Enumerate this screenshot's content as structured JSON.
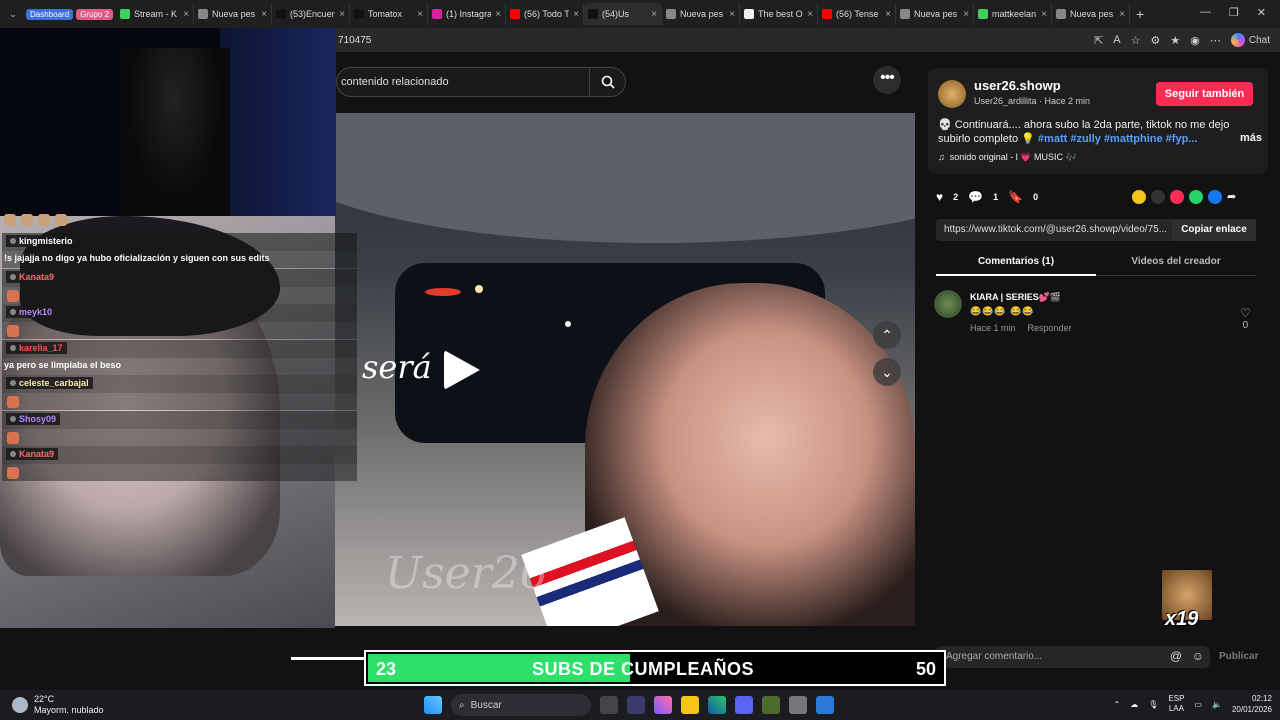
{
  "tabs": {
    "group1": "Dashboard",
    "group2": "Grupo 2",
    "items": [
      {
        "label": "Stream - K",
        "color": "#3ecf5e"
      },
      {
        "label": "Nueva pes",
        "color": "#888888"
      },
      {
        "label": "(53)Encuen",
        "color": "#111111"
      },
      {
        "label": "Tomatox",
        "color": "#111111"
      },
      {
        "label": "(1) Instagra",
        "color": "#d6249f"
      },
      {
        "label": "(56) Todo T",
        "color": "#ff0000"
      },
      {
        "label": "(54)Us",
        "color": "#111111"
      },
      {
        "label": "Nueva pes",
        "color": "#888888"
      },
      {
        "label": "The best O",
        "color": "#eeeeee"
      },
      {
        "label": "(56) Tense",
        "color": "#ff0000"
      },
      {
        "label": "Nueva pes",
        "color": "#888888"
      },
      {
        "label": "mattkeelan",
        "color": "#3ecf5e"
      },
      {
        "label": "Nueva pes",
        "color": "#888888"
      }
    ],
    "new_tab": "+",
    "close": "×"
  },
  "address": {
    "url": "710475",
    "chat": "Chat"
  },
  "search": {
    "text": "contenido relacionado"
  },
  "video": {
    "overlay_text": "será",
    "watermark": "User26"
  },
  "chat": [
    {
      "user": "kingmisterio",
      "color": "#ffffff",
      "msg": "!s jajajja no digo ya hubo oficialización y siguen con sus edits"
    },
    {
      "user": "Kanata9",
      "color": "#ff6b6b",
      "msg": ""
    },
    {
      "user": "meyk10",
      "color": "#b388ff",
      "msg": ""
    },
    {
      "user": "karelia_17",
      "color": "#ff4f4f",
      "msg": "ya pero se limpiaba el beso"
    },
    {
      "user": "celeste_carbajal",
      "color": "#ffe8b0",
      "msg": ""
    },
    {
      "user": "Shosy09",
      "color": "#b388ff",
      "msg": ""
    },
    {
      "user": "Kanata9",
      "color": "#ff6b6b",
      "msg": ""
    }
  ],
  "sidebar": {
    "username": "user26.showp",
    "handle": "User26_ardillita",
    "time": "Hace 2 min",
    "follow": "Seguir también",
    "desc": "💀 Continuará.... ahora subo la 2da parte, tiktok no me dejo subirlo completo 💡",
    "tags": "#matt #zully #mattphine #fyp...",
    "more": "más",
    "music": "sonido original - l 💗 MUSIC 🎶",
    "likes": "2",
    "comments": "1",
    "saves": "0",
    "link": "https://www.tiktok.com/@user26.showp/video/75...",
    "copy": "Copiar enlace",
    "tab_comments": "Comentarios (1)",
    "tab_videos": "Videos del creador",
    "comment": {
      "user": "KIARA | SERIES💕🎬",
      "text": "😂😂😂 😂😂",
      "time": "Hace 1 min",
      "reply": "Responder",
      "likes": "0"
    },
    "placeholder": "Agregar comentario...",
    "publish": "Publicar",
    "meme_count": "x19"
  },
  "subgoal": {
    "current": "23",
    "label": "SUBS DE CUMPLEAÑOS",
    "target": "50",
    "progress": 0.46
  },
  "taskbar": {
    "temp": "22°C",
    "weather": "Mayorm. nublado",
    "search": "Buscar",
    "lang1": "ESP",
    "lang2": "LAA",
    "time": "02:12",
    "date": "20/01/2026"
  }
}
